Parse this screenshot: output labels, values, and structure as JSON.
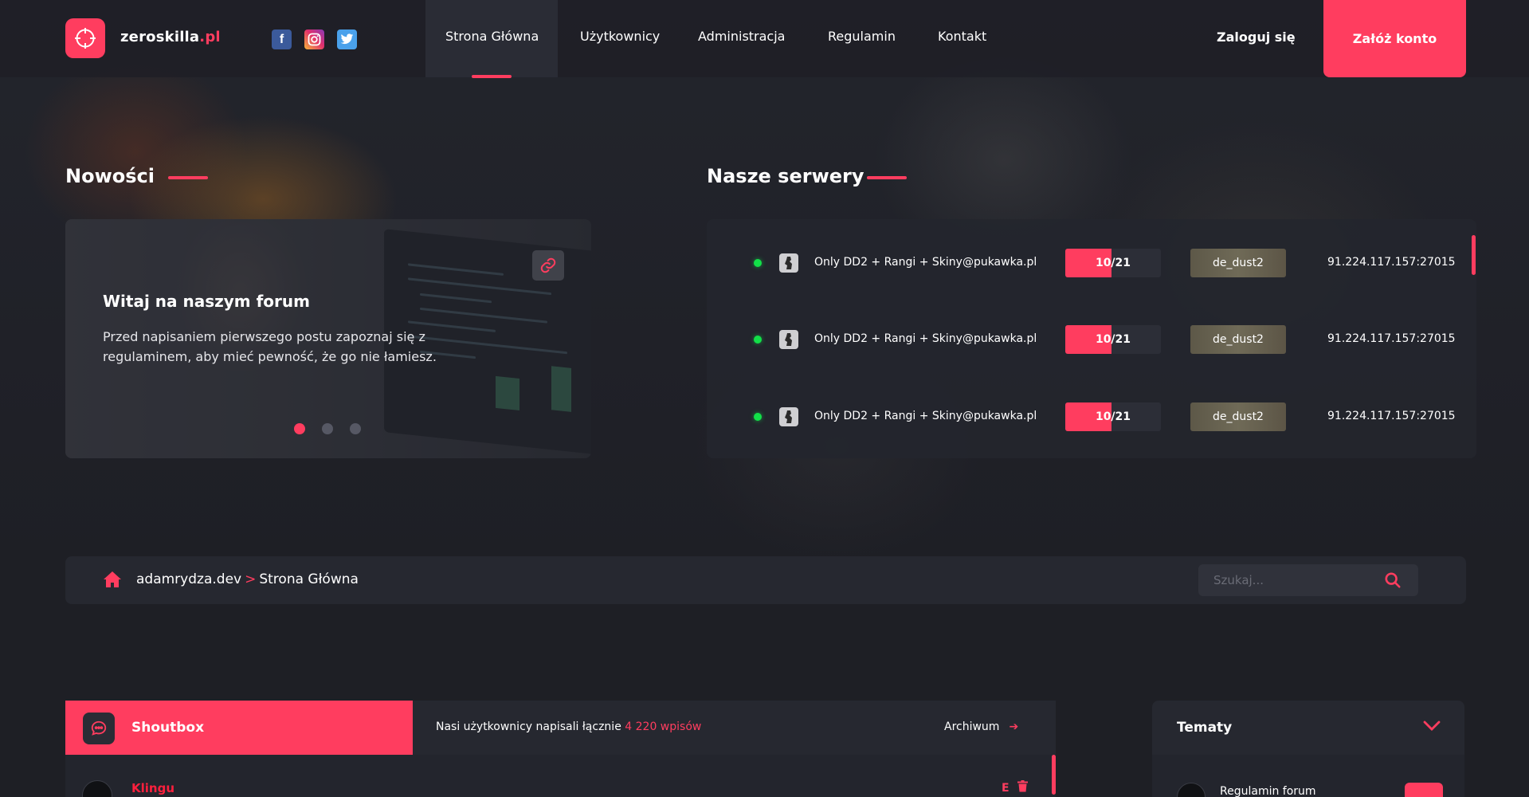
{
  "header": {
    "logo": {
      "name_prefix": "zero",
      "name_middle": "skilla",
      "name_suffix": ".pl"
    },
    "social": [
      "facebook-icon",
      "instagram-icon",
      "twitter-icon"
    ],
    "nav": [
      "Strona Główna",
      "Użytkownicy",
      "Administracja",
      "Regulamin",
      "Kontakt"
    ],
    "active_nav": "Strona Główna",
    "login": "Zaloguj się",
    "register": "Załóż konto"
  },
  "news": {
    "section_title": "Nowości",
    "card_title": "Witaj na naszym forum",
    "card_text": "Przed napisaniem pierwszego postu zapoznaj się z regulaminem, aby mieć pewność, że go nie łamiesz.",
    "slides": 3,
    "active_slide": 1
  },
  "servers": {
    "section_title": "Nasze serwery",
    "rows": [
      {
        "name": "Only DD2 + Rangi + Skiny@pukawka.pl",
        "players": "10/21",
        "fill": 0.48,
        "map": "de_dust2",
        "ip": "91.224.117.157:27015",
        "status": "online"
      },
      {
        "name": "Only DD2 + Rangi + Skiny@pukawka.pl",
        "players": "10/21",
        "fill": 0.48,
        "map": "de_dust2",
        "ip": "91.224.117.157:27015",
        "status": "online"
      },
      {
        "name": "Only DD2 + Rangi + Skiny@pukawka.pl",
        "players": "10/21",
        "fill": 0.48,
        "map": "de_dust2",
        "ip": "91.224.117.157:27015",
        "status": "online"
      }
    ]
  },
  "breadcrumb": {
    "site": "adamrydza.dev",
    "separator": ">",
    "current": "Strona Główna"
  },
  "search": {
    "placeholder": "Szukaj..."
  },
  "shoutbox": {
    "title": "Shoutbox",
    "info_prefix": "Nasi użytkownicy napisali łącznie",
    "info_count": "4 220 wpisów",
    "archive": "Archiwum",
    "entries": [
      {
        "user": "Klingu",
        "edit": "E"
      }
    ]
  },
  "topics": {
    "title": "Tematy",
    "items": [
      "Regulamin forum"
    ]
  },
  "colors": {
    "accent": "#ff3d5f",
    "bg": "#1e1f25",
    "panel": "#262830",
    "online": "#12e048"
  }
}
